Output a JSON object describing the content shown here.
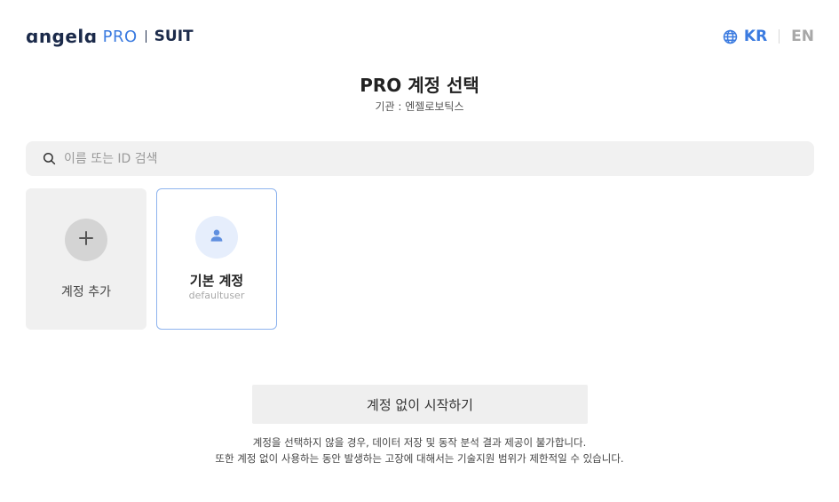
{
  "header": {
    "brand": "ɑngelɑ",
    "pro": "PRO",
    "suit": "SUIT",
    "lang_icon": "globe-icon",
    "lang_kr": "KR",
    "lang_en": "EN",
    "active_lang": "KR"
  },
  "main": {
    "title": "PRO 계정 선택",
    "subtitle": "기관 : 엔젤로보틱스"
  },
  "search": {
    "icon": "search-icon",
    "placeholder": "이름 또는 ID 검색",
    "value": ""
  },
  "accounts": {
    "add": {
      "icon": "plus-icon",
      "label": "계정 추가"
    },
    "items": [
      {
        "icon": "user-icon",
        "name": "기본 계정",
        "id": "defaultuser",
        "selected": true
      }
    ]
  },
  "footer": {
    "start_button": "계정 없이 시작하기",
    "notice_line1": "계정을 선택하지 않을 경우, 데이터 저장 및 동작 분석 결과 제공이 불가합니다.",
    "notice_line2": "또한 계정 없이 사용하는 동안 발생하는 고장에 대해서는 기술지원 범위가 제한적일 수 있습니다."
  },
  "colors": {
    "accent": "#3b7be0",
    "brand_dark": "#1b2a4a",
    "selected_border": "#8fb4ee",
    "card_bg": "#f0f0f0"
  }
}
